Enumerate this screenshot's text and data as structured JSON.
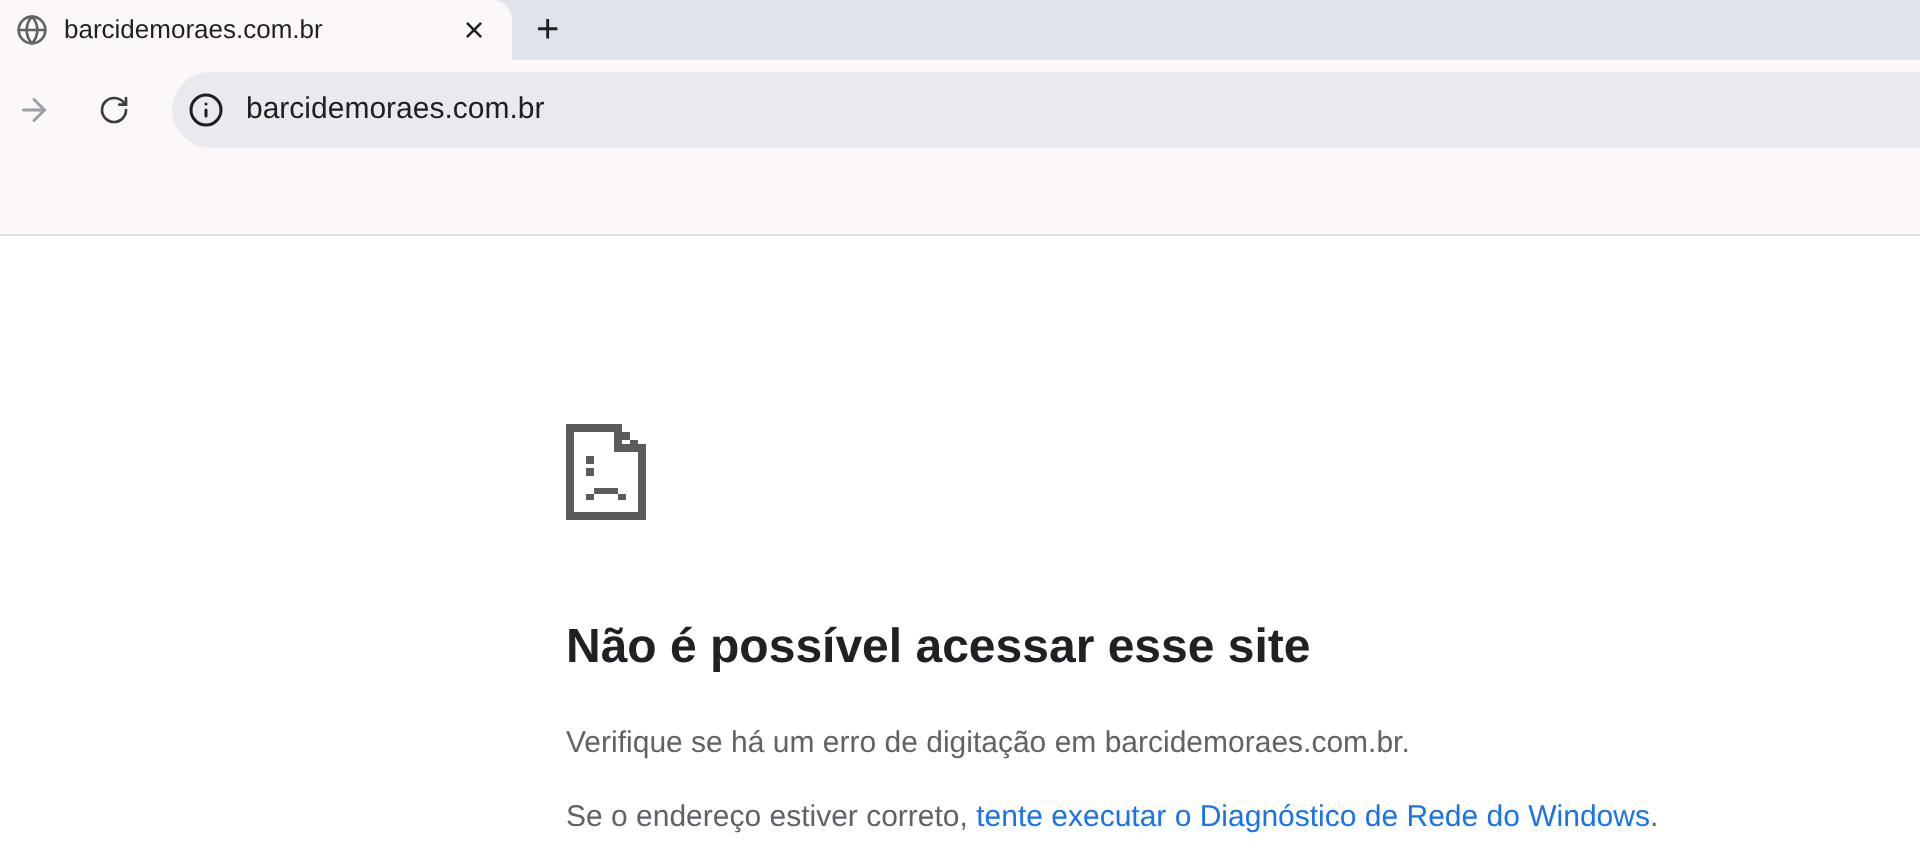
{
  "tab": {
    "title": "barcidemoraes.com.br",
    "close": "×",
    "selected": true
  },
  "new_tab": "+",
  "address_bar": {
    "value": "barcidemoraes.com.br"
  },
  "error": {
    "title": "Não é possível acessar esse site",
    "message": "Verifique se há um erro de digitação em barcidemoraes.com.br.",
    "hint": {
      "prefix": "Se o endereço estiver correto, ",
      "link": "tente executar o Diagnóstico de Rede do Windows",
      "suffix": "."
    }
  }
}
